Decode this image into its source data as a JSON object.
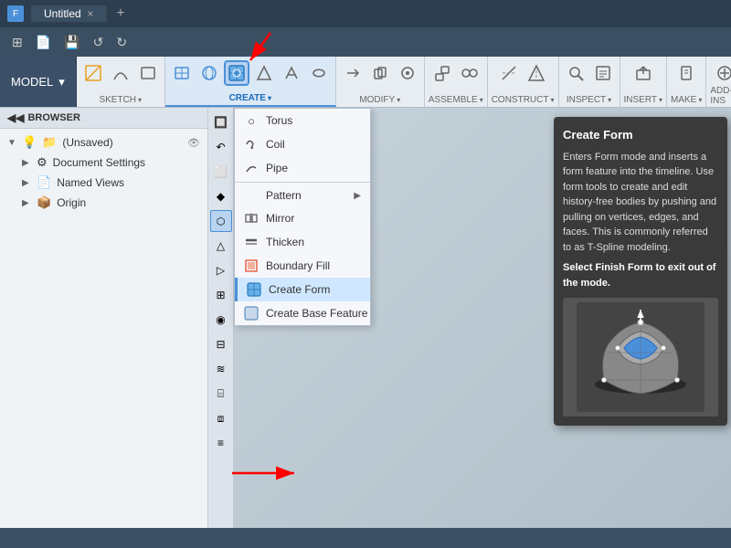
{
  "title_bar": {
    "app_icon": "F",
    "title": "Untitled",
    "close_label": "×",
    "tab_label": "Untitled",
    "tab_add": "+"
  },
  "quick_toolbar": {
    "grid_icon": "⊞",
    "file_icon": "📄",
    "save_icon": "💾",
    "undo_icon": "↺",
    "redo_icon": "↻"
  },
  "main_toolbar": {
    "model_selector": "MODEL",
    "model_dropdown": "▾",
    "groups": [
      {
        "label": "SKETCH",
        "label_arrow": "▾"
      },
      {
        "label": "CREATE",
        "label_arrow": "▾",
        "active": true
      },
      {
        "label": "MODIFY",
        "label_arrow": "▾"
      },
      {
        "label": "ASSEMBLE",
        "label_arrow": "▾"
      },
      {
        "label": "CONSTRUCT",
        "label_arrow": "▾"
      },
      {
        "label": "INSPECT",
        "label_arrow": "▾"
      },
      {
        "label": "INSERT",
        "label_arrow": "▾"
      },
      {
        "label": "MAKE",
        "label_arrow": "▾"
      },
      {
        "label": "ADD-INS",
        "label_arrow": "▾"
      }
    ]
  },
  "browser": {
    "header": "BROWSER",
    "tree_items": [
      {
        "label": "(Unsaved)",
        "icon": "📁",
        "expandable": true,
        "level": 0
      },
      {
        "label": "Document Settings",
        "icon": "⚙",
        "expandable": true,
        "level": 1
      },
      {
        "label": "Named Views",
        "icon": "📄",
        "expandable": true,
        "level": 1
      },
      {
        "label": "Origin",
        "icon": "📦",
        "expandable": true,
        "level": 1
      }
    ]
  },
  "dropdown_menu": {
    "items": [
      {
        "label": "Torus",
        "icon": "○",
        "has_submenu": false
      },
      {
        "label": "Coil",
        "icon": "≋",
        "has_submenu": false
      },
      {
        "label": "Pipe",
        "icon": "⌇",
        "has_submenu": false
      },
      {
        "label": "Pattern",
        "icon": "",
        "has_submenu": true
      },
      {
        "label": "Mirror",
        "icon": "⊟",
        "has_submenu": false
      },
      {
        "label": "Thicken",
        "icon": "◈",
        "has_submenu": false
      },
      {
        "label": "Boundary Fill",
        "icon": "▦",
        "has_submenu": false
      },
      {
        "label": "Create Form",
        "icon": "⬡",
        "has_submenu": false,
        "highlighted": true
      },
      {
        "label": "Create Base Feature",
        "icon": "⬡",
        "has_submenu": false
      }
    ]
  },
  "tooltip": {
    "title": "Create Form",
    "description": "Enters Form mode and inserts a form feature into the timeline. Use form tools to create and edit history-free bodies by pushing and pulling on vertices, edges, and faces. This is commonly referred to as T-Spline modeling.",
    "finish_note": "Select Finish Form to exit out of the mode."
  },
  "status_bar": {
    "text": ""
  }
}
